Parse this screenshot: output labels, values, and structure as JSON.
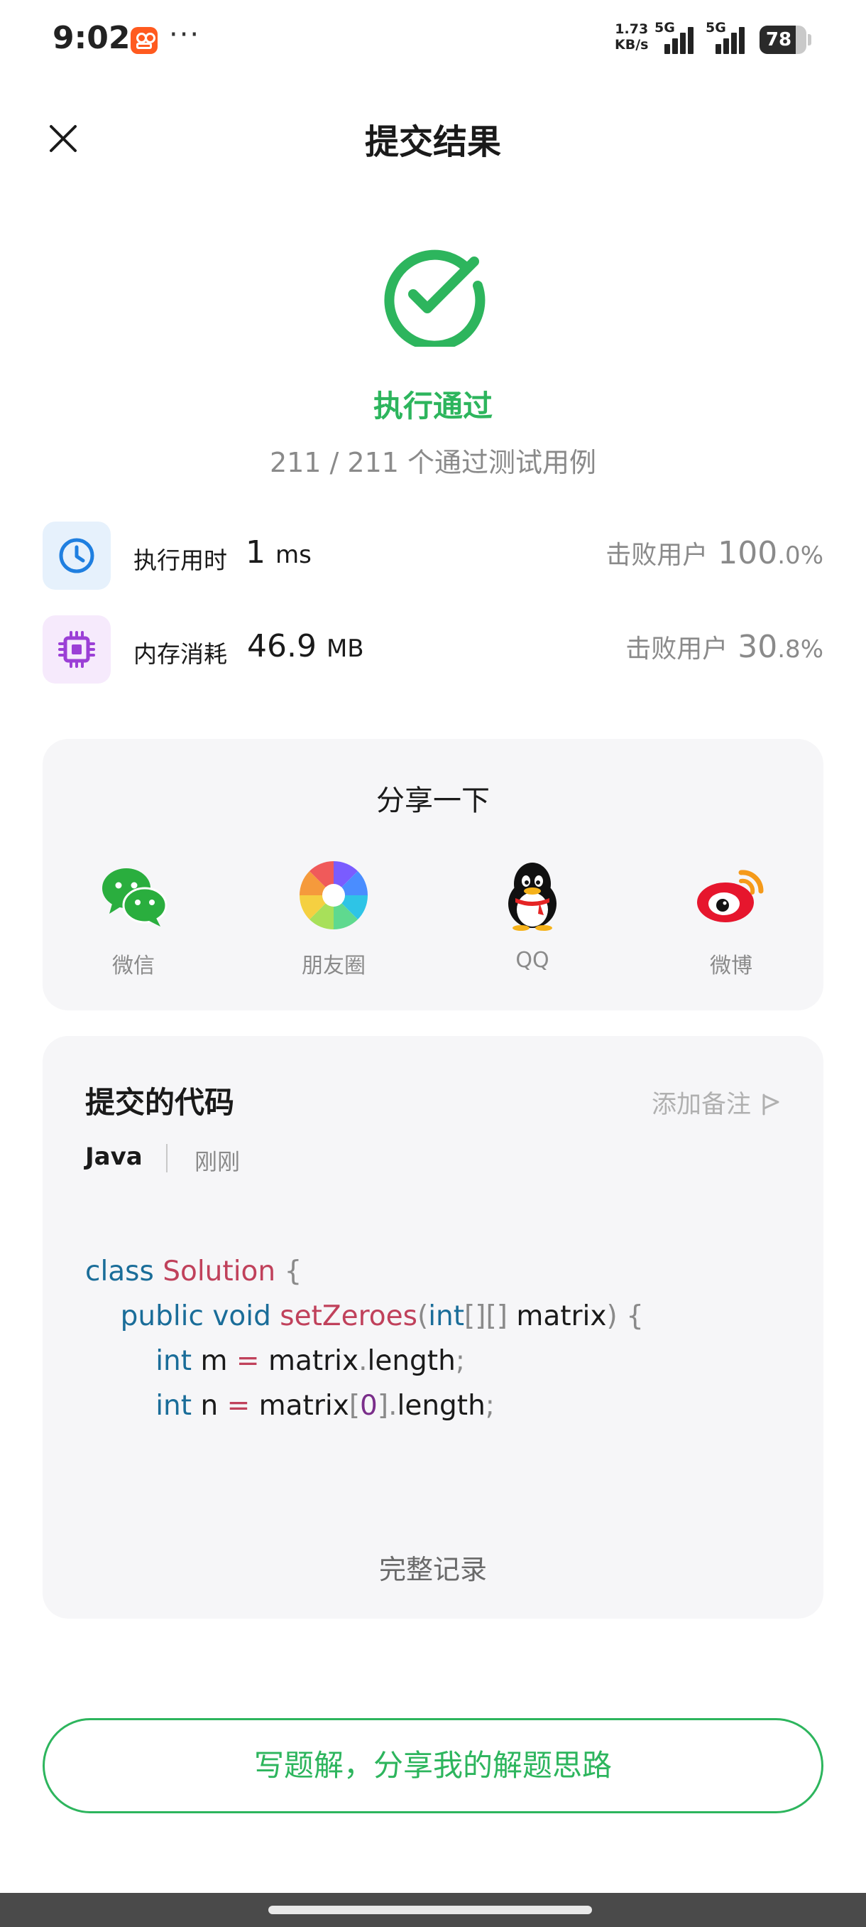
{
  "status_bar": {
    "time": "9:02",
    "dots": "···",
    "speed_value": "1.73",
    "speed_unit": "KB/s",
    "net1": "5G",
    "net2": "5G",
    "battery": "78"
  },
  "header": {
    "title": "提交结果"
  },
  "result": {
    "status": "执行通过",
    "cases": "211 / 211 个通过测试用例",
    "color": "#2db55d"
  },
  "metrics": [
    {
      "icon": "clock-icon",
      "label": "执行用时",
      "value": "1",
      "unit": "ms",
      "beat_label": "击败用户",
      "beat_int": "100",
      "beat_dec": ".0%"
    },
    {
      "icon": "chip-icon",
      "label": "内存消耗",
      "value": "46.9",
      "unit": "MB",
      "beat_label": "击败用户",
      "beat_int": "30",
      "beat_dec": ".8%"
    }
  ],
  "share": {
    "title": "分享一下",
    "items": [
      {
        "icon": "wechat-icon",
        "label": "微信"
      },
      {
        "icon": "moments-icon",
        "label": "朋友圈"
      },
      {
        "icon": "qq-icon",
        "label": "QQ"
      },
      {
        "icon": "weibo-icon",
        "label": "微博"
      }
    ]
  },
  "code": {
    "title": "提交的代码",
    "add_note": "添加备注",
    "language": "Java",
    "time": "刚刚",
    "full_record": "完整记录",
    "tokens": {
      "class_kw": "class",
      "class_name": "Solution",
      "brace_open": "{",
      "public_kw": "public",
      "void_kw": "void",
      "method": "setZeroes",
      "paren_open": "(",
      "int_kw": "int",
      "brackets": "[][]",
      "param": "matrix",
      "paren_close": ")",
      "var_m": "m",
      "var_n": "n",
      "eq": "=",
      "matrix": "matrix",
      "dot": ".",
      "length": "length",
      "semi": ";",
      "idx_open": "[",
      "zero": "0",
      "idx_close": "]"
    }
  },
  "bottom_button": {
    "label": "写题解，分享我的解题思路"
  }
}
